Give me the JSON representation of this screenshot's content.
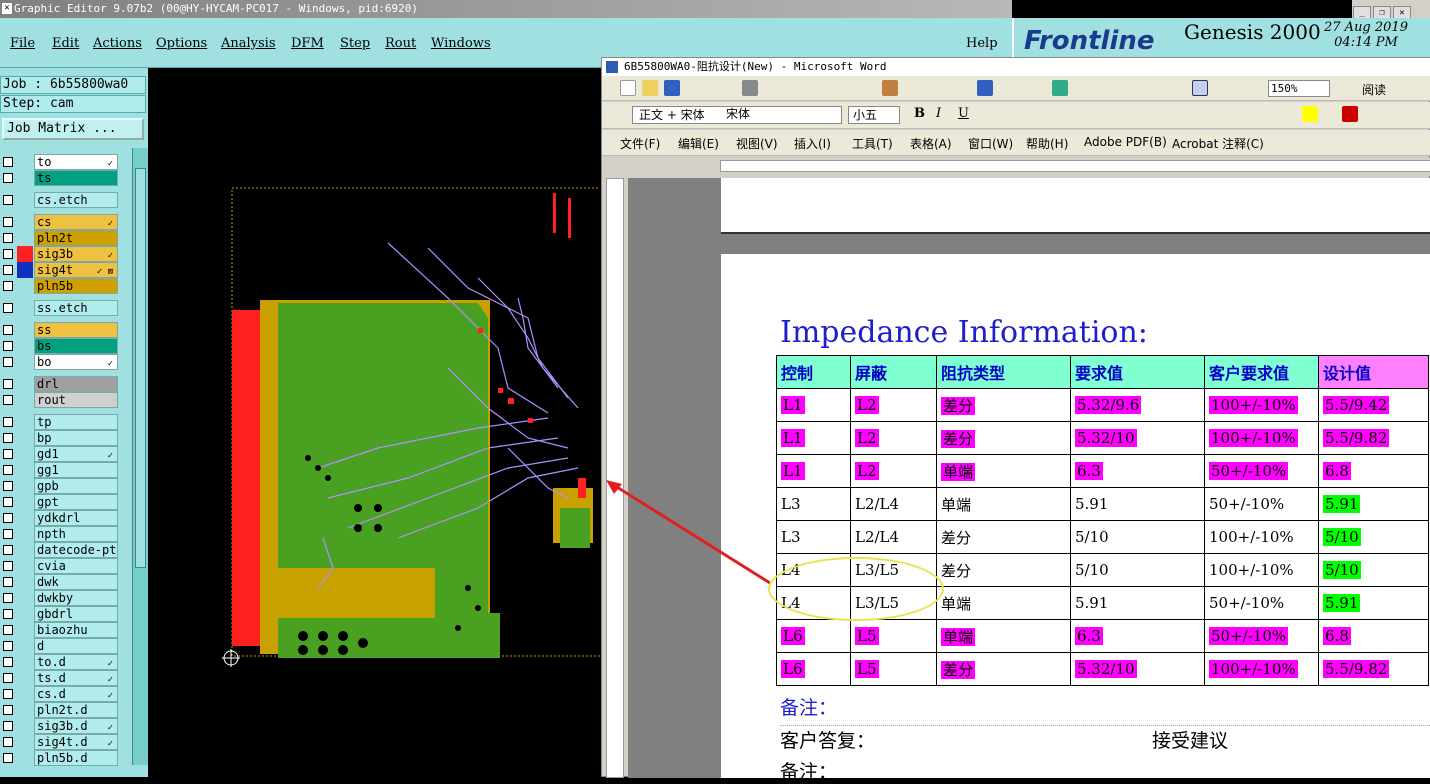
{
  "genesis": {
    "title": "Graphic Editor 9.07b2 (00@HY-HYCAM-PC017 - Windows, pid:6920)",
    "menu": [
      "File",
      "Edit",
      "Actions",
      "Options",
      "Analysis",
      "DFM",
      "Step",
      "Rout",
      "Windows"
    ],
    "help": "Help",
    "logo": {
      "brand": "Frontline",
      "product": "Genesis 2000",
      "date": "27 Aug 2019",
      "time": "04:14 PM"
    },
    "job": "Job : 6b55800wa0",
    "step": "Step: cam",
    "job_matrix": "Job Matrix ...",
    "layers": [
      {
        "name": "to",
        "color": "#ffffff",
        "mark": "✓"
      },
      {
        "name": "ts",
        "color": "#00a080",
        "mark": ""
      },
      {
        "name": "cs.etch",
        "color": "#b0ecec",
        "mark": ""
      },
      {
        "name": "cs",
        "color": "#f0c040",
        "mark": "✓"
      },
      {
        "name": "pln2t",
        "color": "#d0a000",
        "mark": ""
      },
      {
        "name": "sig3b",
        "color": "#f0c040",
        "mark": "✓"
      },
      {
        "name": "sig4t",
        "color": "#f0c040",
        "mark": "✓ ⊠"
      },
      {
        "name": "pln5b",
        "color": "#d0a000",
        "mark": ""
      },
      {
        "name": "ss.etch",
        "color": "#b0ecec",
        "mark": ""
      },
      {
        "name": "ss",
        "color": "#f0c040",
        "mark": ""
      },
      {
        "name": "bs",
        "color": "#00a080",
        "mark": ""
      },
      {
        "name": "bo",
        "color": "#ffffff",
        "mark": "✓"
      },
      {
        "name": "drl",
        "color": "#a0a0a0",
        "mark": ""
      },
      {
        "name": "rout",
        "color": "#d0d0d0",
        "mark": ""
      },
      {
        "name": "tp",
        "color": "#b0ecec",
        "mark": ""
      },
      {
        "name": "bp",
        "color": "#b0ecec",
        "mark": ""
      },
      {
        "name": "gd1",
        "color": "#b0ecec",
        "mark": "✓"
      },
      {
        "name": "gg1",
        "color": "#b0ecec",
        "mark": ""
      },
      {
        "name": "gpb",
        "color": "#b0ecec",
        "mark": ""
      },
      {
        "name": "gpt",
        "color": "#b0ecec",
        "mark": ""
      },
      {
        "name": "ydkdrl",
        "color": "#b0ecec",
        "mark": ""
      },
      {
        "name": "npth",
        "color": "#b0ecec",
        "mark": ""
      },
      {
        "name": "datecode-pt",
        "color": "#b0ecec",
        "mark": ""
      },
      {
        "name": "cvia",
        "color": "#b0ecec",
        "mark": ""
      },
      {
        "name": "dwk",
        "color": "#b0ecec",
        "mark": ""
      },
      {
        "name": "dwkby",
        "color": "#b0ecec",
        "mark": ""
      },
      {
        "name": "gbdrl",
        "color": "#b0ecec",
        "mark": ""
      },
      {
        "name": "biaozhu",
        "color": "#b0ecec",
        "mark": ""
      },
      {
        "name": "d",
        "color": "#b0ecec",
        "mark": ""
      },
      {
        "name": "to.d",
        "color": "#b0ecec",
        "mark": "✓"
      },
      {
        "name": "ts.d",
        "color": "#b0ecec",
        "mark": "✓"
      },
      {
        "name": "cs.d",
        "color": "#b0ecec",
        "mark": "✓"
      },
      {
        "name": "pln2t.d",
        "color": "#b0ecec",
        "mark": ""
      },
      {
        "name": "sig3b.d",
        "color": "#b0ecec",
        "mark": "✓"
      },
      {
        "name": "sig4t.d",
        "color": "#b0ecec",
        "mark": "✓"
      },
      {
        "name": "pln5b.d",
        "color": "#b0ecec",
        "mark": ""
      }
    ]
  },
  "word": {
    "title": "6B55800WA0-阻抗设计(New) - Microsoft Word",
    "style_box": "正文 + 宋体",
    "font_box": "宋体",
    "size_box": "小五",
    "zoom": "150%",
    "read_btn": "阅读",
    "menu": [
      "文件(F)",
      "编辑(E)",
      "视图(V)",
      "插入(I)",
      "工具(T)",
      "表格(A)",
      "窗口(W)",
      "帮助(H)",
      "Adobe PDF(B)",
      "Acrobat 注释(C)"
    ],
    "heading": "Impedance Information:",
    "table": {
      "headers": [
        "控制",
        "屏蔽",
        "阻抗类型",
        "要求值",
        "客户要求值",
        "设计值"
      ],
      "rows": [
        [
          "L1",
          "L2",
          "差分",
          "5.32/9.6",
          "100+/-10%",
          "5.5/9.42"
        ],
        [
          "L1",
          "L2",
          "差分",
          "5.32/10",
          "100+/-10%",
          "5.5/9.82"
        ],
        [
          "L1",
          "L2",
          "单端",
          "6.3",
          "50+/-10%",
          "6.8"
        ],
        [
          "L3",
          "L2/L4",
          "单端",
          "5.91",
          "50+/-10%",
          "5.91"
        ],
        [
          "L3",
          "L2/L4",
          "差分",
          "5/10",
          "100+/-10%",
          "5/10"
        ],
        [
          "L4",
          "L3/L5",
          "差分",
          "5/10",
          "100+/-10%",
          "5/10"
        ],
        [
          "L4",
          "L3/L5",
          "单端",
          "5.91",
          "50+/-10%",
          "5.91"
        ],
        [
          "L6",
          "L5",
          "单端",
          "6.3",
          "50+/-10%",
          "6.8"
        ],
        [
          "L6",
          "L5",
          "差分",
          "5.32/10",
          "100+/-10%",
          "5.5/9.82"
        ]
      ],
      "highlights": [
        "mmmmmm",
        "mmmmmm",
        "mmmmmm",
        "-----g",
        "-----g",
        "-----g",
        "-----g",
        "mmmmmm",
        "mmmmmm"
      ]
    },
    "remark1": "备注：",
    "reply_label": "客户答复：",
    "reply_value": "接受建议",
    "remark2": "备注："
  },
  "colors": {
    "genesis_bg": "#a0e0e0",
    "pcb_green": "#4aa020",
    "pcb_red": "#ff2020",
    "pcb_gold": "#c8a000",
    "highlight_magenta": "#ff00ff",
    "highlight_green": "#00ff00",
    "arrow_red": "#e02020",
    "ellipse_yellow": "#e6e64a"
  }
}
